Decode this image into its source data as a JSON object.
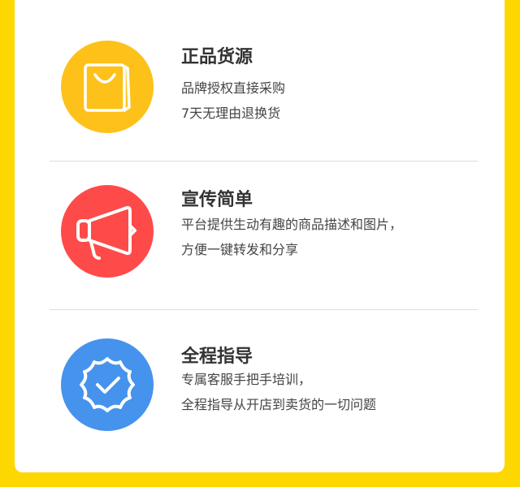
{
  "colors": {
    "background": "#FDD700",
    "yellow": "#FDC11A",
    "red": "#FF4A4A",
    "blue": "#4593EC"
  },
  "features": [
    {
      "icon": "shopping-bag-icon",
      "title": "正品货源",
      "lines": [
        "品牌授权直接采购",
        "7天无理由退换货"
      ]
    },
    {
      "icon": "megaphone-icon",
      "title": "宣传简单",
      "lines": [
        "平台提供生动有趣的商品描述和图片，",
        "方便一键转发和分享"
      ]
    },
    {
      "icon": "verified-badge-icon",
      "title": "全程指导",
      "lines": [
        "专属客服手把手培训，",
        "全程指导从开店到卖货的一切问题"
      ]
    }
  ]
}
